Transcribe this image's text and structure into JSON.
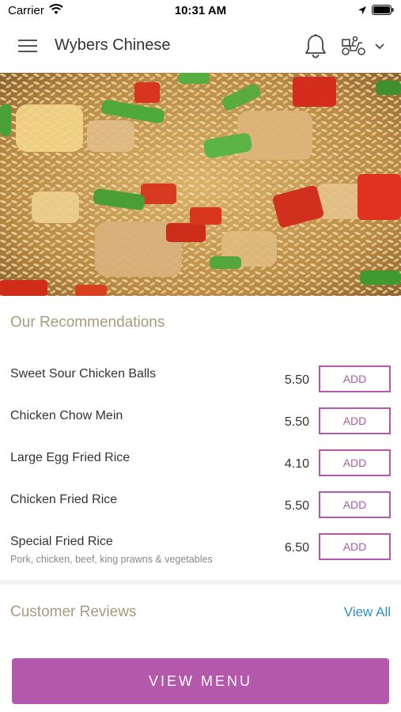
{
  "status_bar": {
    "carrier": "Carrier",
    "time": "10:31 AM",
    "icons": [
      "wifi-icon",
      "location-arrow-icon",
      "battery-icon"
    ]
  },
  "header": {
    "title": "Wybers Chinese",
    "icons": [
      "hamburger-menu-icon",
      "bell-icon",
      "scooter-delivery-icon",
      "chevron-down-icon"
    ]
  },
  "hero": {
    "description_icon": "fried-rice-photo"
  },
  "recommendations": {
    "title": "Our Recommendations",
    "add_label": "ADD",
    "items": [
      {
        "name": "Sweet Sour Chicken Balls",
        "price": "5.50",
        "add_label": "ADD"
      },
      {
        "name": "Chicken Chow Mein",
        "price": "5.50",
        "add_label": "ADD"
      },
      {
        "name": "Large Egg Fried Rice",
        "price": "4.10",
        "add_label": "ADD"
      },
      {
        "name": "Chicken Fried Rice",
        "price": "5.50",
        "add_label": "ADD"
      },
      {
        "name": "Special Fried Rice",
        "description": "Pork, chicken, beef, king prawns & vegetables",
        "price": "6.50",
        "add_label": "ADD"
      }
    ]
  },
  "reviews": {
    "title": "Customer Reviews",
    "view_all_label": "View All"
  },
  "footer": {
    "view_menu_label": "VIEW MENU"
  },
  "colors": {
    "accent": "#b358aa",
    "section_title": "#a89b7a",
    "link": "#2e8fc0"
  }
}
